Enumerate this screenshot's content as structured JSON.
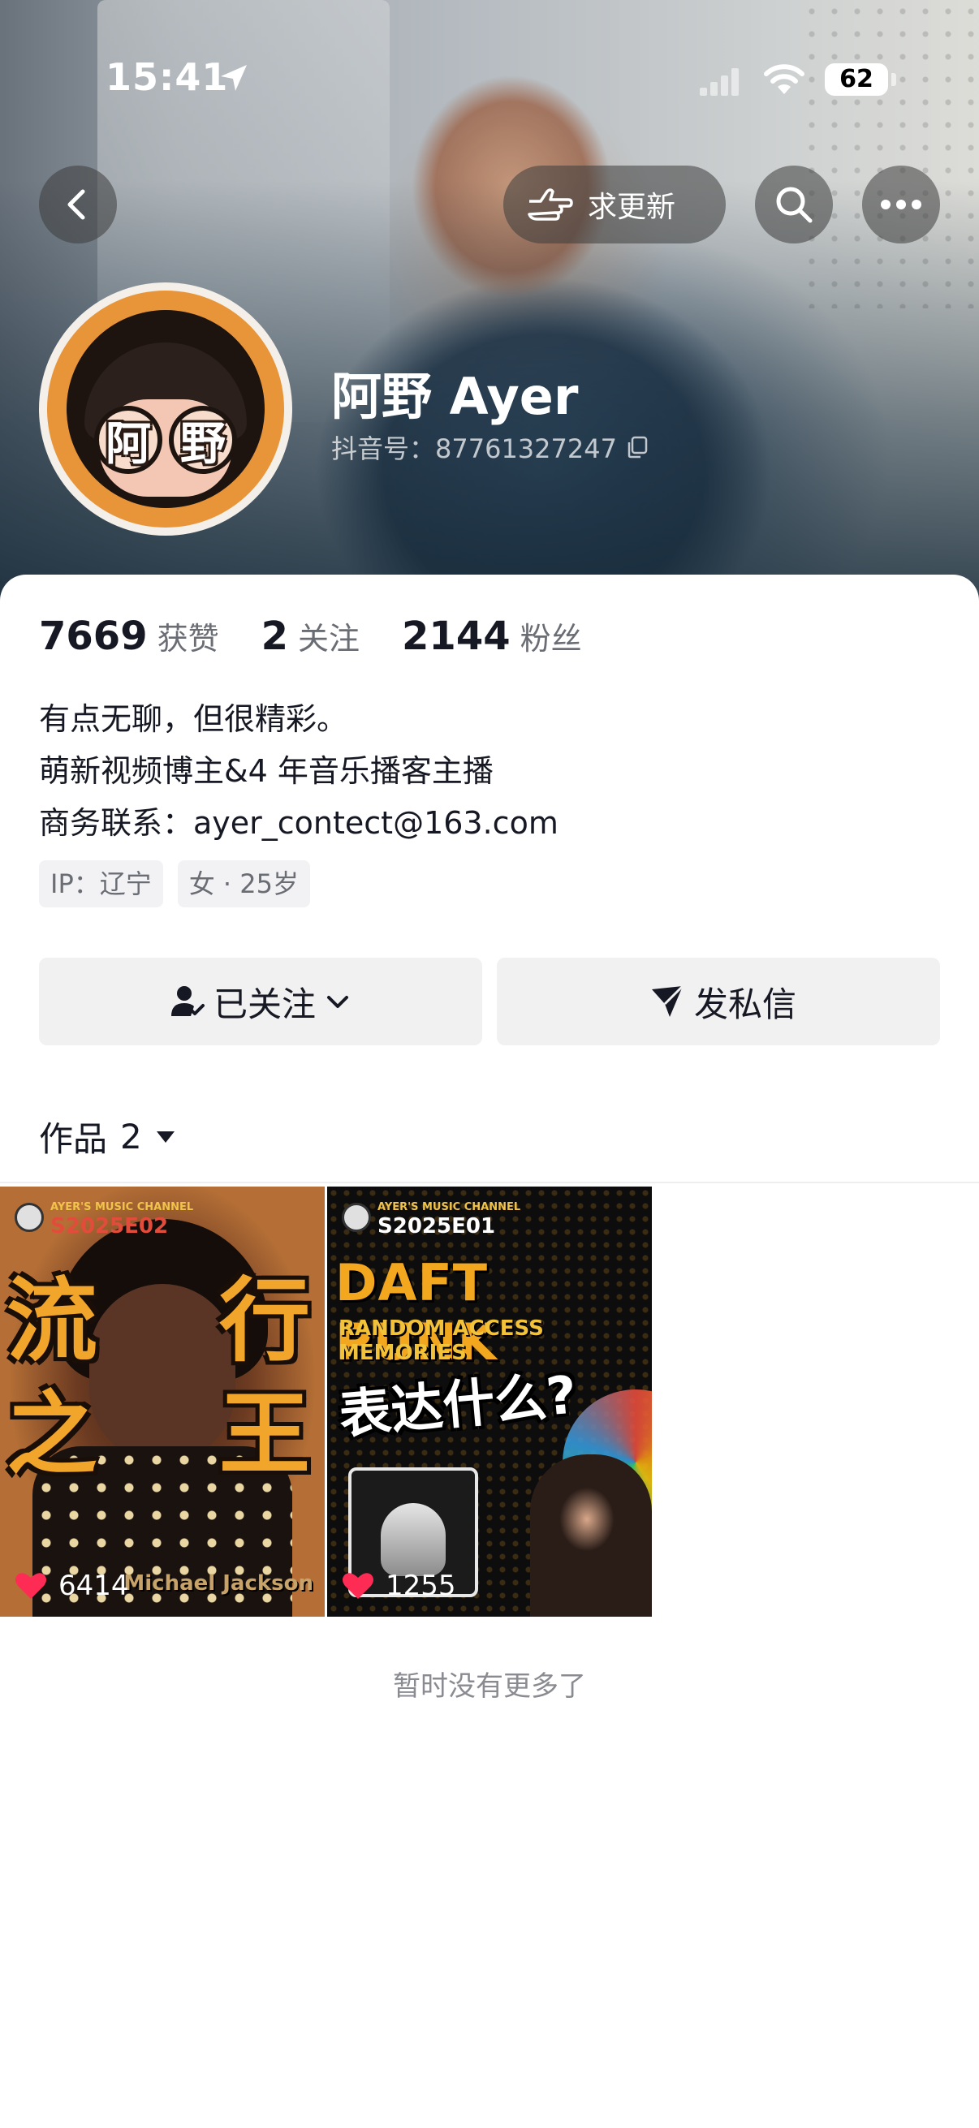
{
  "status_bar": {
    "time": "15:41",
    "battery": "62"
  },
  "header": {
    "update_button_label": "求更新",
    "avatar_text_left": "阿",
    "avatar_text_right": "野",
    "name": "阿野 Ayer",
    "douyin_id": "抖音号：87761327247"
  },
  "stats": [
    {
      "value": "7669",
      "label": "获赞"
    },
    {
      "value": "2",
      "label": "关注"
    },
    {
      "value": "2144",
      "label": "粉丝"
    }
  ],
  "bio": {
    "line1": "有点无聊，但很精彩。",
    "line2": "萌新视频博主&4 年音乐播客主播",
    "line3": "商务联系：ayer_contect@163.com"
  },
  "tags": {
    "ip": "IP：辽宁",
    "gender_age": "女 · 25岁"
  },
  "actions": {
    "follow_label": "已关注",
    "message_label": "发私信"
  },
  "works": {
    "label": "作品",
    "count": "2"
  },
  "videos": [
    {
      "channel": "AYER'S MUSIC CHANNEL",
      "episode": "S2025E02",
      "title_chars": [
        "流",
        "行",
        "之",
        "王"
      ],
      "artist": "Michael Jackson",
      "likes": "6414"
    },
    {
      "channel": "AYER'S MUSIC CHANNEL",
      "episode": "S2025E01",
      "title": "DAFT PUNK",
      "subtitle": "RANDOM ACCESS MEMORIES",
      "question": "表达什么?",
      "likes": "1255"
    }
  ],
  "footer": {
    "no_more": "暂时没有更多了"
  },
  "colors": {
    "like_heart": "#fe2c55",
    "accent_orange": "#f1a52b"
  }
}
